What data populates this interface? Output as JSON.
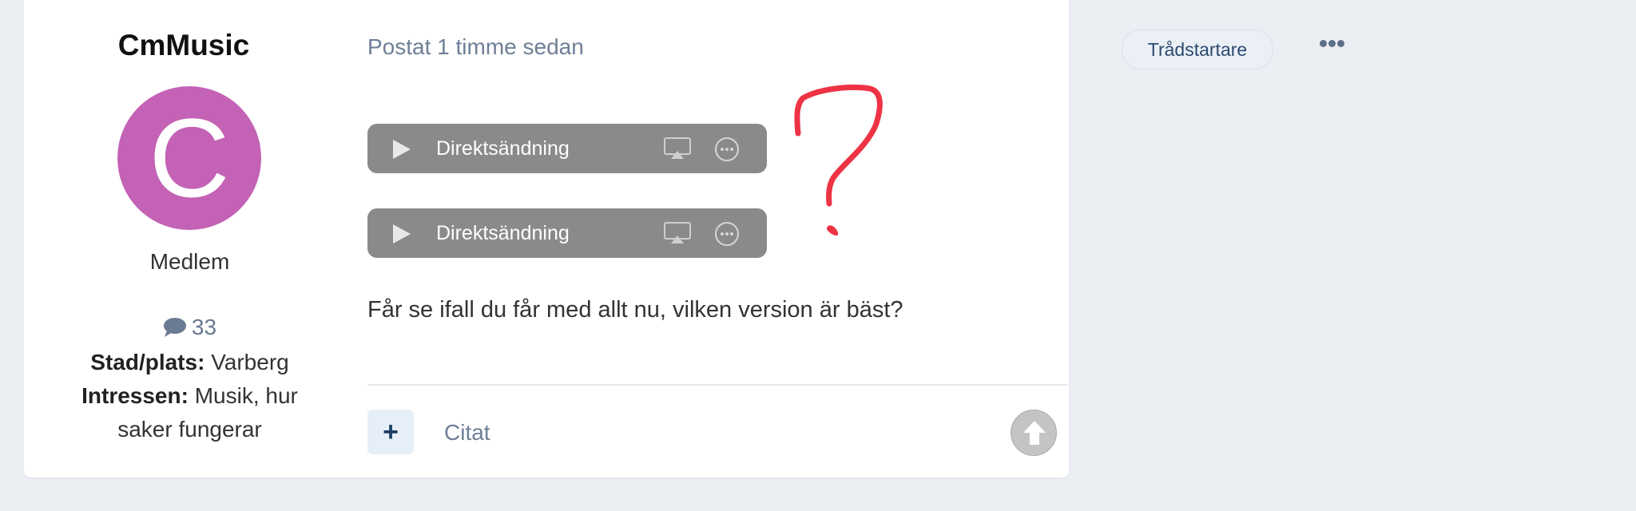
{
  "author": {
    "name": "CmMusic",
    "avatar_letter": "C",
    "avatar_color": "#c462b5",
    "role": "Medlem",
    "post_count": "33",
    "fields": [
      {
        "label": "Stad/plats:",
        "value": "Varberg"
      },
      {
        "label": "Intressen:",
        "value": "Musik, hur saker fungerar"
      }
    ]
  },
  "post": {
    "date": "Postat 1 timme sedan",
    "badge": "Trådstartare",
    "menu_icon": "ellipsis-icon",
    "audio_players": [
      {
        "label": "Direktsändning"
      },
      {
        "label": "Direktsändning"
      }
    ],
    "annotation": "?",
    "text": "Får se ifall du får med allt nu, vilken version är bäst?",
    "footer": {
      "add_icon": "plus-icon",
      "quote_label": "Citat",
      "scroll_icon": "arrow-up-icon"
    }
  },
  "colors": {
    "background": "#ebeef3",
    "accent": "#1d3e63",
    "annotation": "#ee3344"
  }
}
